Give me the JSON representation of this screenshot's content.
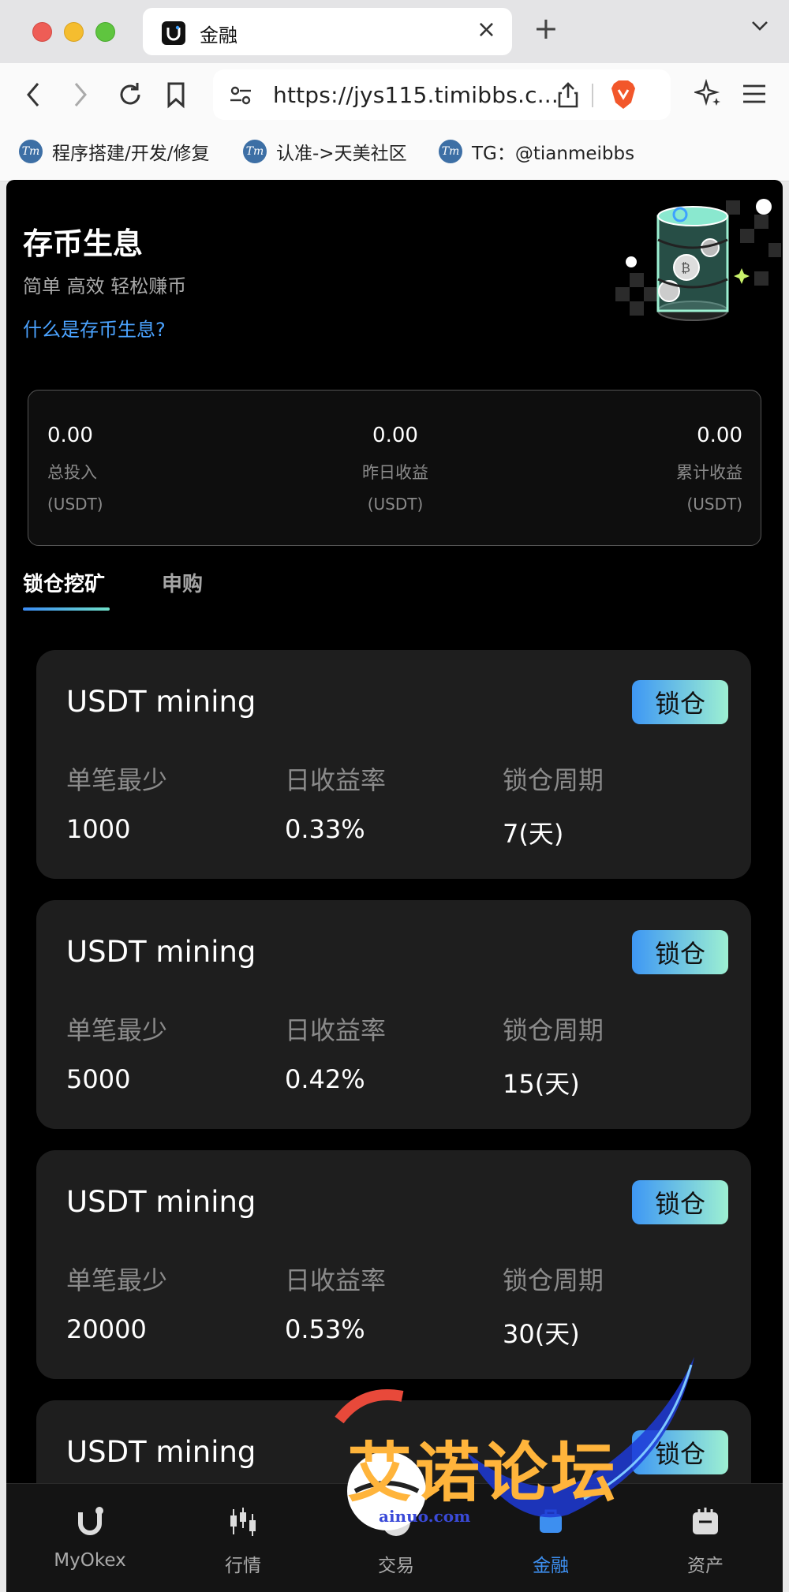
{
  "browser": {
    "tab_title": "金融",
    "url": "https://jys115.timibbs.c...",
    "bookmarks": [
      {
        "label": "程序搭建/开发/修复"
      },
      {
        "label": "认准->天美社区"
      },
      {
        "label": "TG：@tianmeibbs"
      }
    ]
  },
  "hero": {
    "title": "存币生息",
    "subtitle": "简单 高效 轻松赚币",
    "link": "什么是存币生息?"
  },
  "summary": [
    {
      "value": "0.00",
      "label": "总投入",
      "unit": "(USDT)"
    },
    {
      "value": "0.00",
      "label": "昨日收益",
      "unit": "(USDT)"
    },
    {
      "value": "0.00",
      "label": "累计收益",
      "unit": "(USDT)"
    }
  ],
  "tabs": [
    {
      "label": "锁仓挖矿",
      "active": true
    },
    {
      "label": "申购",
      "active": false
    }
  ],
  "products": [
    {
      "title": "USDT mining",
      "button": "锁仓",
      "min_label": "单笔最少",
      "min_value": "1000",
      "rate_label": "日收益率",
      "rate_value": "0.33%",
      "period_label": "锁仓周期",
      "period_value": "7(天)"
    },
    {
      "title": "USDT mining",
      "button": "锁仓",
      "min_label": "单笔最少",
      "min_value": "5000",
      "rate_label": "日收益率",
      "rate_value": "0.42%",
      "period_label": "锁仓周期",
      "period_value": "15(天)"
    },
    {
      "title": "USDT mining",
      "button": "锁仓",
      "min_label": "单笔最少",
      "min_value": "20000",
      "rate_label": "日收益率",
      "rate_value": "0.53%",
      "period_label": "锁仓周期",
      "period_value": "30(天)"
    },
    {
      "title": "USDT mining",
      "button": "锁仓"
    }
  ],
  "bottom_nav": [
    {
      "label": "MyOkex",
      "icon": "logo-icon",
      "active": false
    },
    {
      "label": "行情",
      "icon": "candlestick-icon",
      "active": false
    },
    {
      "label": "交易",
      "icon": "exchange-icon",
      "active": false
    },
    {
      "label": "金融",
      "icon": "finance-icon",
      "active": true
    },
    {
      "label": "资产",
      "icon": "wallet-icon",
      "active": false
    }
  ],
  "watermark": {
    "text": "艾诺论坛",
    "sub": "ainuo.com"
  },
  "colors": {
    "accent_blue": "#3d8ff0",
    "link_blue": "#4ba3ff",
    "button_gradient_start": "#3e97f4",
    "button_gradient_end": "#9df0d2",
    "card_bg": "#1e1e1e",
    "page_bg": "#000000"
  }
}
